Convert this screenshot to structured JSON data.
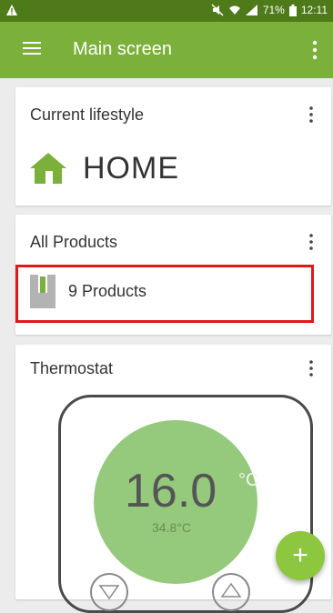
{
  "status_bar": {
    "battery": "71%",
    "time": "12:11",
    "icons": [
      "warning-icon",
      "mute-icon",
      "wifi-icon",
      "signal-icon",
      "battery-icon"
    ]
  },
  "app_bar": {
    "title": "Main screen",
    "icons": [
      "hamburger-menu-icon",
      "overflow-menu-icon"
    ]
  },
  "cards": {
    "lifestyle": {
      "title": "Current lifestyle",
      "value": "HOME",
      "icon": "house-icon"
    },
    "products": {
      "title": "All Products",
      "item_label": "9 Products",
      "icon": "product-box-icon"
    },
    "thermostat": {
      "title": "Thermostat",
      "set_temp": "16.0",
      "unit": "°C",
      "current_temp": "34.8°C"
    }
  },
  "fab": {
    "label": "+"
  },
  "colors": {
    "status_bar": "#4f7a1a",
    "app_bar": "#7bb13a",
    "accent": "#8dc63f",
    "dial": "#95c97c",
    "highlight": "#e01818"
  }
}
